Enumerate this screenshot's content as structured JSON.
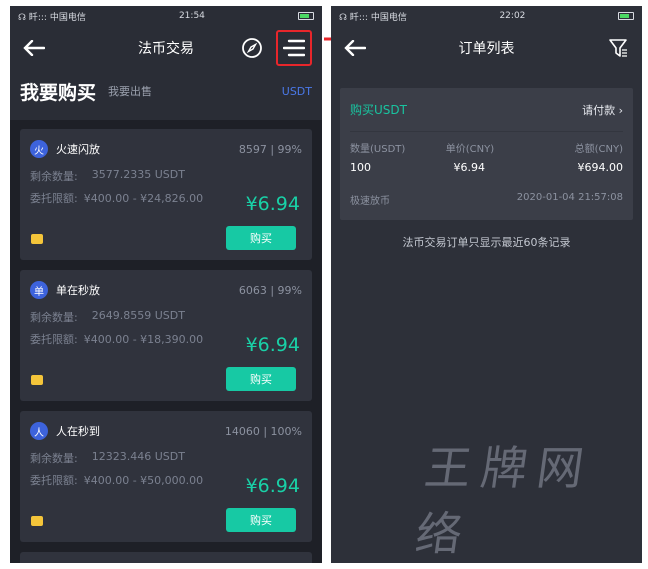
{
  "left": {
    "status": {
      "carrier": "中国电信",
      "signal": "☊ 䀒:::",
      "time": "21:54"
    },
    "nav": {
      "title": "法币交易"
    },
    "header": {
      "buy_label": "我要购买",
      "sell_label": "我要出售",
      "coin": "USDT"
    },
    "offers": [
      {
        "avatar": "火",
        "name": "火速闪放",
        "stats": "8597 | 99%",
        "remaining_label": "剩余数量:",
        "remaining": "3577.2335 USDT",
        "limit_label": "委托限额:",
        "limit": "¥400.00 - ¥24,826.00",
        "price": "¥6.94",
        "buy_label": "购买"
      },
      {
        "avatar": "单",
        "name": "单在秒放",
        "stats": "6063 | 99%",
        "remaining_label": "剩余数量:",
        "remaining": "2649.8559 USDT",
        "limit_label": "委托限额:",
        "limit": "¥400.00 - ¥18,390.00",
        "price": "¥6.94",
        "buy_label": "购买"
      },
      {
        "avatar": "人",
        "name": "人在秒到",
        "stats": "14060 | 100%",
        "remaining_label": "剩余数量:",
        "remaining": "12323.446 USDT",
        "limit_label": "委托限额:",
        "limit": "¥400.00 - ¥50,000.00",
        "price": "¥6.94",
        "buy_label": "购买"
      }
    ]
  },
  "right": {
    "status": {
      "carrier": "中国电信",
      "signal": "☊ 䀒:::",
      "time": "22:02"
    },
    "nav": {
      "title": "订单列表"
    },
    "order": {
      "type": "购买USDT",
      "status": "请付款 ›",
      "col_qty": "数量(USDT)",
      "col_price": "单价(CNY)",
      "col_total": "总额(CNY)",
      "qty": "100",
      "price": "¥6.94",
      "total": "¥694.00",
      "release": "极速放币",
      "datetime": "2020-01-04 21:57:08"
    },
    "notice": "法币交易订单只显示最近60条记录",
    "watermark": "王牌网络"
  },
  "colors": {
    "accent_green": "#19d1a7",
    "accent_blue": "#4a78e8",
    "highlight_red": "#e8262b"
  }
}
